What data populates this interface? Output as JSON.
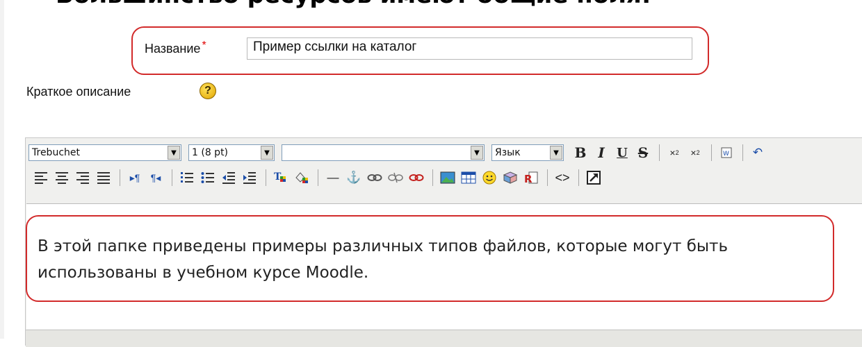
{
  "heading": "Большинство ресурсов имеют общие поля:",
  "form": {
    "name_label": "Название",
    "required_mark": "*",
    "name_value": "Пример ссылки на каталог",
    "summary_label": "Краткое описание",
    "help_glyph": "?"
  },
  "toolbar": {
    "font_family": "Trebuchet",
    "font_size": "1 (8 pt)",
    "format_value": "",
    "language": "Язык",
    "bold": "B",
    "italic": "I",
    "underline": "U",
    "strike": "S"
  },
  "icons": {
    "row1_extra": [
      "subscript-icon",
      "superscript-icon",
      "paste-word-icon",
      "undo-icon"
    ],
    "row2": [
      "align-left-icon",
      "align-center-icon",
      "align-right-icon",
      "justify-icon",
      "ltr-icon",
      "rtl-icon",
      "ordered-list-icon",
      "unordered-list-icon",
      "outdent-icon",
      "indent-icon",
      "text-color-icon",
      "background-color-icon",
      "horizontal-rule-icon",
      "anchor-icon",
      "link-icon",
      "unlink-icon",
      "nolink-icon",
      "image-icon",
      "table-icon",
      "smiley-icon",
      "insert-file-icon",
      "search-replace-icon",
      "html-source-icon",
      "fullscreen-icon"
    ]
  },
  "editor": {
    "content": "В этой папке приведены примеры различных типов файлов, которые могут быть использованы в учебном курсе Moodle."
  },
  "colors": {
    "annotation": "#d22a2a",
    "required": "#e00000"
  }
}
